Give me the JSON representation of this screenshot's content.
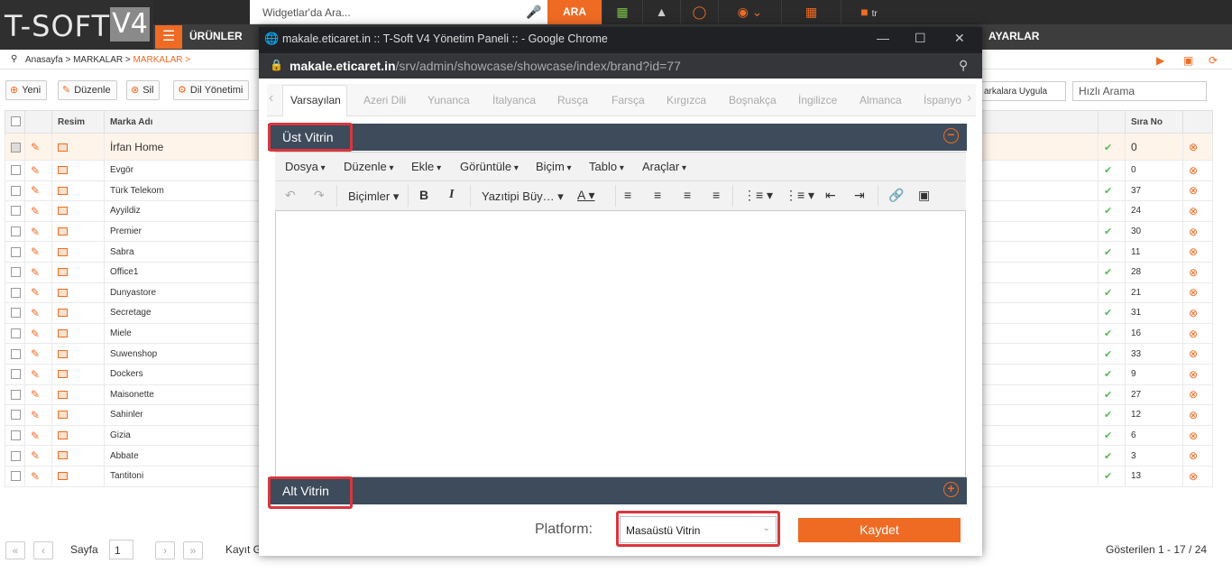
{
  "topbar": {
    "search_placeholder": "Widgetlar'da Ara...",
    "search_button": "ARA",
    "lang": "tr"
  },
  "logo": {
    "text": "T-SOFT",
    "version": "V4"
  },
  "nav": {
    "urunler": "ÜRÜNLER",
    "ayarlar": "AYARLAR"
  },
  "breadcrumb": {
    "path": "Anasayfa > MARKALAR > ",
    "current": "MARKALAR >"
  },
  "toolbar": {
    "yeni": "Yeni",
    "duzenle": "Düzenle",
    "sil": "Sil",
    "dil": "Dil Yönetimi",
    "markalara_uygula": "arkalara Uygula",
    "hizli_arama": "Hızlı Arama"
  },
  "table": {
    "headers": {
      "resim": "Resim",
      "marka": "Marka Adı",
      "sira": "Sıra No"
    },
    "rows": [
      {
        "name": "İrfan Home",
        "sira": "0"
      },
      {
        "name": "Evgör",
        "sira": "0"
      },
      {
        "name": "Türk Telekom",
        "sira": "37"
      },
      {
        "name": "Ayyildiz",
        "sira": "24"
      },
      {
        "name": "Premier",
        "sira": "30"
      },
      {
        "name": "Sabra",
        "sira": "11"
      },
      {
        "name": "Office1",
        "sira": "28"
      },
      {
        "name": "Dunyastore",
        "sira": "21"
      },
      {
        "name": "Secretage",
        "sira": "31"
      },
      {
        "name": "Miele",
        "sira": "16"
      },
      {
        "name": "Suwenshop",
        "sira": "33"
      },
      {
        "name": "Dockers",
        "sira": "9"
      },
      {
        "name": "Maisonette",
        "sira": "27"
      },
      {
        "name": "Sahinler",
        "sira": "12"
      },
      {
        "name": "Gizia",
        "sira": "6"
      },
      {
        "name": "Abbate",
        "sira": "3"
      },
      {
        "name": "Tantitoni",
        "sira": "13"
      }
    ]
  },
  "pager": {
    "sayfa": "Sayfa",
    "page": "1",
    "kayit": "Kayıt G",
    "gosterilen": "Gösterilen 1 - 17 / 24"
  },
  "popup": {
    "window_title": "makale.eticaret.in :: T-Soft V4 Yönetim Paneli :: - Google Chrome",
    "url_domain": "makale.eticaret.in",
    "url_path": "/srv/admin/showcase/showcase/index/brand?id=77",
    "tabs": [
      "Varsayılan",
      "Azeri Dili",
      "Yunanca",
      "İtalyanca",
      "Rusça",
      "Farsça",
      "Kırgızca",
      "Boşnakça",
      "İngilizce",
      "Almanca",
      "İspanyo"
    ],
    "ust_vitrin": "Üst Vitrin",
    "alt_vitrin": "Alt Vitrin",
    "menus": [
      "Dosya",
      "Düzenle",
      "Ekle",
      "Görüntüle",
      "Biçim",
      "Tablo",
      "Araçlar"
    ],
    "bicimler": "Biçimler",
    "yazitipi": "Yazıtipi Büy…",
    "platform_label": "Platform:",
    "platform_value": "Masaüstü Vitrin",
    "kaydet": "Kaydet"
  }
}
